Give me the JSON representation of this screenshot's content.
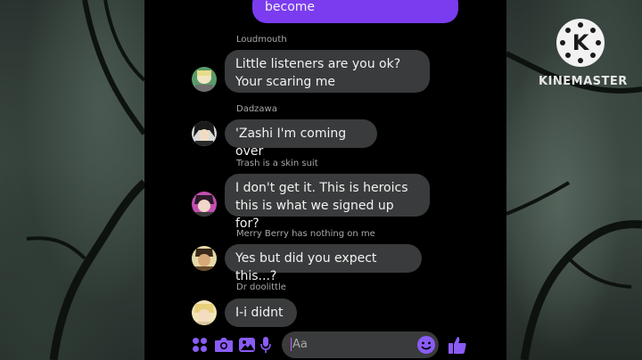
{
  "top_message": {
    "text": "become"
  },
  "messages": [
    {
      "sender": "Loudmouth",
      "lines": [
        "Little listeners are you ok?",
        "Your scaring me"
      ]
    },
    {
      "sender": "Dadzawa",
      "lines": [
        "'Zashi I'm coming over"
      ]
    },
    {
      "sender": "Trash is a skin suit",
      "lines": [
        "I don't get it. This is heroics",
        "this is what we signed up for?"
      ]
    },
    {
      "sender": "Merry Berry has nothing on me",
      "lines": [
        "Yes but did you expect this...?"
      ]
    },
    {
      "sender": "Dr doolittle",
      "lines": [
        "I-i didnt"
      ]
    }
  ],
  "composer": {
    "placeholder": "Aa"
  },
  "watermark": {
    "brand": "KINEMASTER",
    "logo_letter": "K"
  },
  "colors": {
    "accent": "#7b3cf0",
    "bubble_received": "#3a3b3c",
    "composer_icons": "#8a5cf6"
  },
  "icons": [
    "grid-icon",
    "camera-icon",
    "image-icon",
    "microphone-icon",
    "emoji-icon",
    "thumbs-up-icon"
  ]
}
